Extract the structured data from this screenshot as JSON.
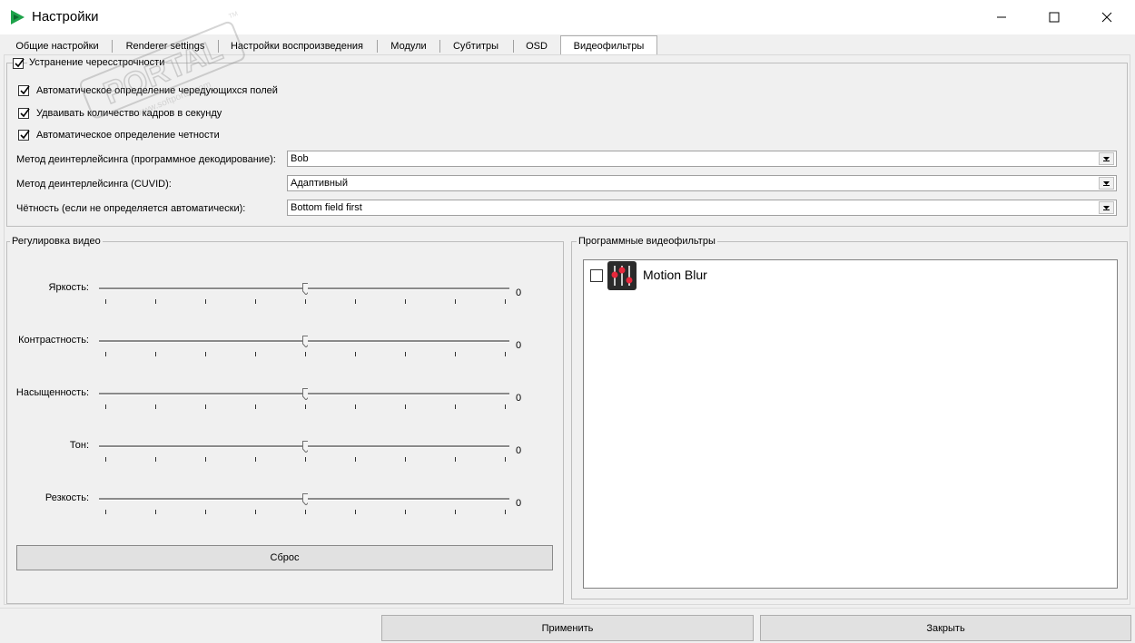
{
  "window": {
    "title": "Настройки",
    "controls": {
      "minimize": "minimize-icon",
      "maximize": "maximize-icon",
      "close": "close-icon"
    }
  },
  "tabs": [
    {
      "label": "Общие настройки",
      "active": false
    },
    {
      "label": "Renderer settings",
      "active": false
    },
    {
      "label": "Настройки воспроизведения",
      "active": false
    },
    {
      "label": "Модули",
      "active": false
    },
    {
      "label": "Субтитры",
      "active": false
    },
    {
      "label": "OSD",
      "active": false
    },
    {
      "label": "Видеофильтры",
      "active": true
    }
  ],
  "deinterlace": {
    "group_label": "Устранение чересстрочности",
    "group_checked": true,
    "options": [
      {
        "label": "Автоматическое определение чередующихся полей",
        "checked": true
      },
      {
        "label": "Удваивать количество кадров в секунду",
        "checked": true
      },
      {
        "label": "Автоматическое определение четности",
        "checked": true
      }
    ],
    "fields": [
      {
        "label": "Метод деинтерлейсинга (программное декодирование):",
        "value": "Bob"
      },
      {
        "label": "Метод деинтерлейсинга (CUVID):",
        "value": "Адаптивный"
      },
      {
        "label": "Чётность (если не определяется автоматически):",
        "value": "Bottom field first"
      }
    ]
  },
  "video_adjust": {
    "title": "Регулировка видео",
    "sliders": [
      {
        "label": "Яркость:",
        "value": "0"
      },
      {
        "label": "Контрастность:",
        "value": "0"
      },
      {
        "label": "Насыщенность:",
        "value": "0"
      },
      {
        "label": "Тон:",
        "value": "0"
      },
      {
        "label": "Резкость:",
        "value": "0"
      }
    ],
    "reset_label": "Сброс"
  },
  "software_filters": {
    "title": "Программные видеофильтры",
    "items": [
      {
        "label": "Motion Blur",
        "checked": false,
        "icon": "equalizer-icon"
      }
    ]
  },
  "footer": {
    "apply_label": "Применить",
    "close_label": "Закрыть"
  },
  "watermark": {
    "text": "PORTAL",
    "url": "www.softportal.com",
    "tm": "TM"
  },
  "colors": {
    "accent_red": "#e8283c",
    "app_icon_green": "#1ea34a"
  }
}
